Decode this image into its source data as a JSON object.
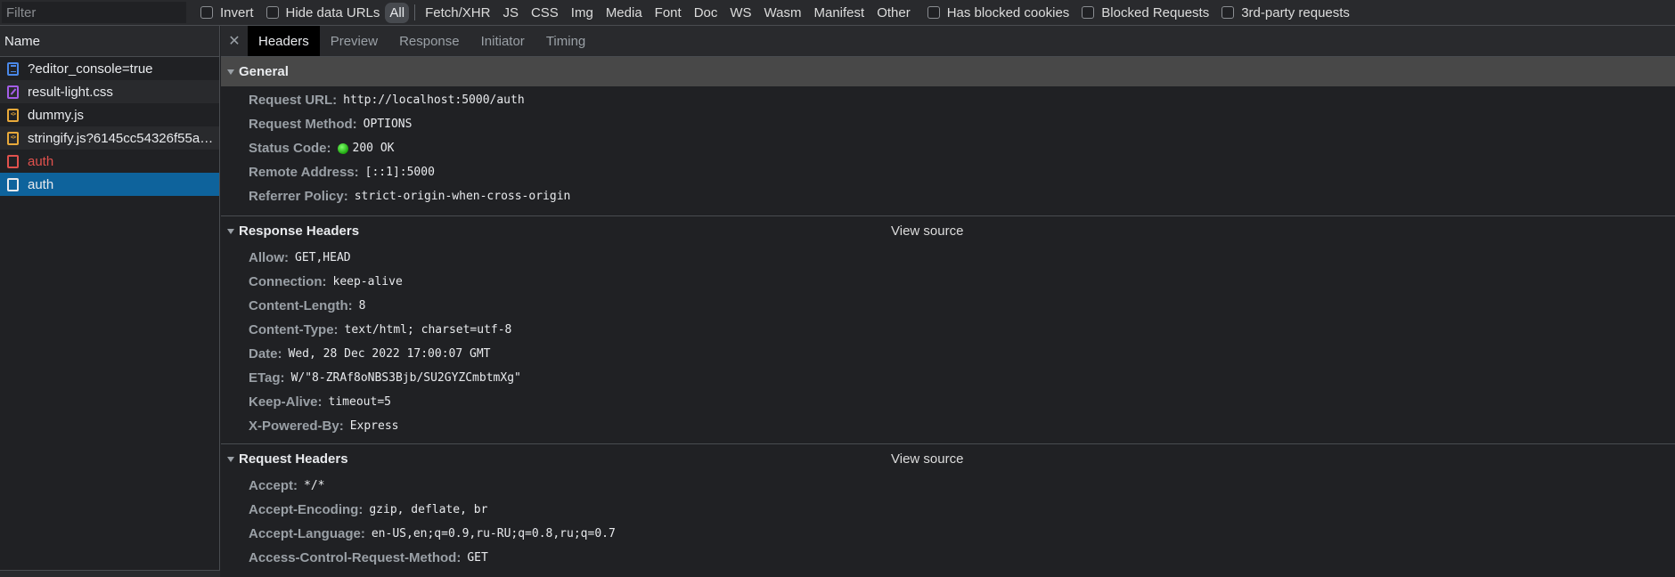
{
  "toolbar": {
    "filter_placeholder": "Filter",
    "checkboxes": [
      {
        "label": "Invert",
        "checked": false
      },
      {
        "label": "Hide data URLs",
        "checked": false
      }
    ],
    "types": [
      "All",
      "Fetch/XHR",
      "JS",
      "CSS",
      "Img",
      "Media",
      "Font",
      "Doc",
      "WS",
      "Wasm",
      "Manifest",
      "Other"
    ],
    "active_type": "All",
    "extra_checkboxes": [
      {
        "label": "Has blocked cookies",
        "checked": false
      },
      {
        "label": "Blocked Requests",
        "checked": false
      },
      {
        "label": "3rd-party requests",
        "checked": false
      }
    ]
  },
  "requests": {
    "column_header": "Name",
    "items": [
      {
        "name": "?editor_console=true",
        "icon": "document-icon",
        "state": "normal"
      },
      {
        "name": "result-light.css",
        "icon": "stylesheet-icon",
        "state": "normal"
      },
      {
        "name": "dummy.js",
        "icon": "script-icon",
        "state": "normal"
      },
      {
        "name": "stringify.js?6145cc54326f55ae...",
        "icon": "script-icon",
        "state": "normal"
      },
      {
        "name": "auth",
        "icon": "request-icon",
        "state": "error"
      },
      {
        "name": "auth",
        "icon": "request-icon",
        "state": "selected"
      }
    ]
  },
  "details": {
    "close_icon": "close-icon",
    "tabs": [
      "Headers",
      "Preview",
      "Response",
      "Initiator",
      "Timing"
    ],
    "active_tab": "Headers",
    "general": {
      "title": "General",
      "rows": [
        {
          "key": "Request URL:",
          "value": "http://localhost:5000/auth"
        },
        {
          "key": "Request Method:",
          "value": "OPTIONS"
        },
        {
          "key": "Status Code:",
          "value": "200 OK",
          "status_color": "#22c414"
        },
        {
          "key": "Remote Address:",
          "value": "[::1]:5000"
        },
        {
          "key": "Referrer Policy:",
          "value": "strict-origin-when-cross-origin"
        }
      ]
    },
    "response_headers": {
      "title": "Response Headers",
      "view_source": "View source",
      "rows": [
        {
          "key": "Allow:",
          "value": "GET,HEAD"
        },
        {
          "key": "Connection:",
          "value": "keep-alive"
        },
        {
          "key": "Content-Length:",
          "value": "8"
        },
        {
          "key": "Content-Type:",
          "value": "text/html; charset=utf-8"
        },
        {
          "key": "Date:",
          "value": "Wed, 28 Dec 2022 17:00:07 GMT"
        },
        {
          "key": "ETag:",
          "value": "W/\"8-ZRAf8oNBS3Bjb/SU2GYZCmbtmXg\""
        },
        {
          "key": "Keep-Alive:",
          "value": "timeout=5"
        },
        {
          "key": "X-Powered-By:",
          "value": "Express"
        }
      ]
    },
    "request_headers": {
      "title": "Request Headers",
      "view_source": "View source",
      "rows": [
        {
          "key": "Accept:",
          "value": "*/*"
        },
        {
          "key": "Accept-Encoding:",
          "value": "gzip, deflate, br"
        },
        {
          "key": "Accept-Language:",
          "value": "en-US,en;q=0.9,ru-RU;q=0.8,ru;q=0.7"
        },
        {
          "key": "Access-Control-Request-Method:",
          "value": "GET"
        }
      ]
    }
  }
}
